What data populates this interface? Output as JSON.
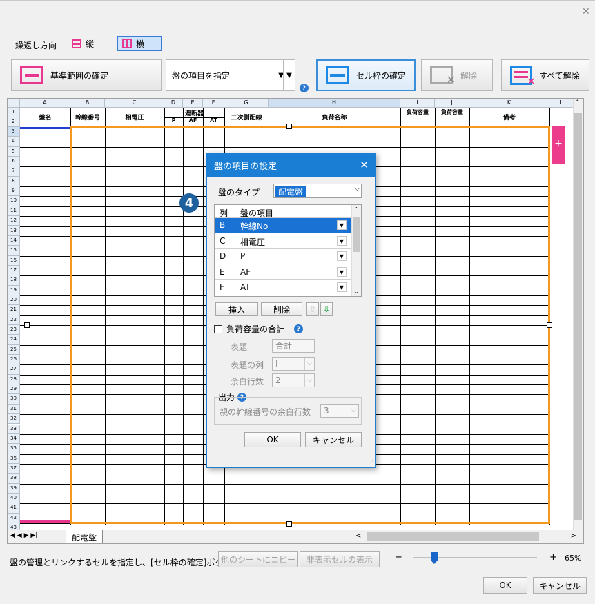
{
  "toolbar": {
    "repeat_label": "繰返し方向",
    "dir_vertical": "縦",
    "dir_horizontal": "横",
    "btn_base_range": "基準範囲の確定",
    "panel_select_value": "盤の項目を指定",
    "btn_cell_frame": "セル枠の確定",
    "btn_release": "解除",
    "btn_release_all": "すべて解除",
    "help": "?"
  },
  "sheet": {
    "col_letters": [
      "A",
      "B",
      "C",
      "D",
      "E",
      "F",
      "G",
      "H",
      "I",
      "J",
      "K",
      "L"
    ],
    "headers": {
      "A": "盤名",
      "B": "幹線番号",
      "C": "相電圧",
      "DEF": "遮断器",
      "D": "P",
      "E": "AF",
      "F": "AT",
      "G": "二次側配線",
      "H": "負荷名称",
      "I": "負荷容量",
      "J": "負荷容量",
      "K": "備考"
    },
    "tab_name": "配電盤",
    "nav": "◀ ◀ ▶ ▶|",
    "plus": "+"
  },
  "step_badge": "4",
  "dialog": {
    "title": "盤の項目の設定",
    "panel_type_label": "盤のタイプ",
    "panel_type_value": "配電盤",
    "list_header_col": "列",
    "list_header_item": "盤の項目",
    "items": [
      {
        "col": "B",
        "name": "幹線No",
        "selected": true
      },
      {
        "col": "C",
        "name": "相電圧",
        "selected": false
      },
      {
        "col": "D",
        "name": "P",
        "selected": false
      },
      {
        "col": "E",
        "name": "AF",
        "selected": false
      },
      {
        "col": "F",
        "name": "AT",
        "selected": false
      }
    ],
    "btn_insert": "挿入",
    "btn_delete": "削除",
    "sum_checkbox": "負荷容量の合計",
    "title_label": "表題",
    "title_value": "合計",
    "title_col_label": "表題の列",
    "title_col_value": "I",
    "blank_rows_label": "余白行数",
    "blank_rows_value": "2",
    "output_label": "出力",
    "parent_blank_label": "親の幹線番号の余白行数",
    "parent_blank_value": "3",
    "btn_ok": "OK",
    "btn_cancel": "キャンセル"
  },
  "footer": {
    "status_text": "盤の管理とリンクするセルを指定し、[セル枠の確定]ボタ...",
    "btn_copy_sheet": "他のシートにコピー",
    "btn_show_hidden": "非表示セルの表示",
    "zoom_minus": "−",
    "zoom_plus": "+",
    "zoom_value": "65%",
    "btn_ok": "OK",
    "btn_cancel": "キャンセル"
  }
}
